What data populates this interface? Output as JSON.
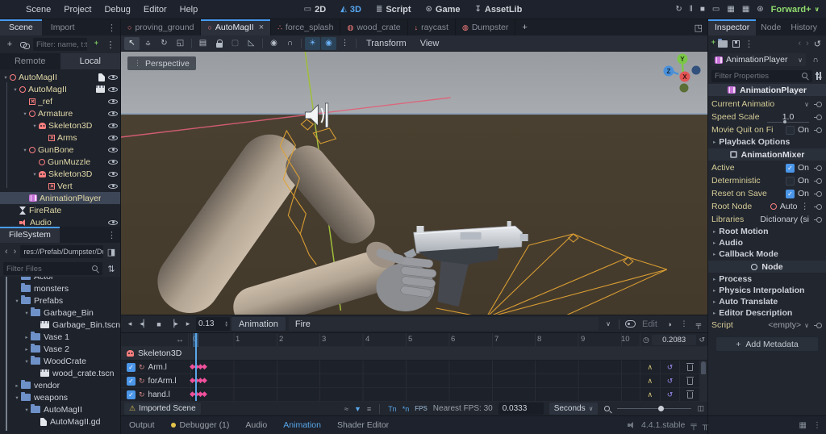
{
  "colors": {
    "accent_blue": "#479df3",
    "node_red": "#fc7f7f",
    "anim_purple": "#c874d8",
    "keyframe_pink": "#ee4f96",
    "bone_orange": "#e0a233",
    "warning_yellow": "#e0c24c",
    "renderer_green": "#8fd96d",
    "folder_blue": "#6e91c8",
    "node_name_gold": "#e3daa9"
  },
  "icons": {
    "kebab": "⋮",
    "chevron_down": "∨",
    "caret_right": "▸",
    "caret_down": "▾",
    "back": "‹",
    "forward": "›",
    "plus": "+",
    "close": "×",
    "warning": "⚠",
    "sun": "☀",
    "environment": "◉",
    "select": "↖",
    "rotate": "↻",
    "scale": "◱",
    "history": "↺",
    "stop": "■",
    "play": "▸",
    "play_back": "◂",
    "bar_l": "▏",
    "bar_r": "▕",
    "pan": "↔",
    "clock": "◷",
    "loop": "↺",
    "wrap": "∧",
    "bezier": "≈",
    "funnel": "▼",
    "list": "≡",
    "onion": "◑",
    "pin": "╤",
    "dock": "╥",
    "grid": "▦",
    "snap": "∩",
    "ruler": "◺",
    "select_list": "▤",
    "group": "▢",
    "maximize": "◳",
    "spin_up": "▴",
    "spin_down": "▾",
    "check": "✓",
    "diamond": "◆",
    "raycast": "↓",
    "particles": "∴",
    "sphere": "◍",
    "circle": "○",
    "fit": "◫",
    "split": "◨",
    "sort": "⇅",
    "move_h": "↔",
    "move_v": "↕",
    "ws_2d": "▭",
    "ws_3d": "◭",
    "ws_script": "≣",
    "ws_game": "⊙",
    "ws_asset": "↧",
    "run_restart": "↻",
    "run_pause": "‖",
    "run_stop": "■",
    "run_remote": "▭",
    "run_movie": "▦",
    "run_custom": "⊛",
    "tn": "Tn",
    "an": "*n"
  },
  "menu_bar": {
    "items": [
      "Scene",
      "Project",
      "Debug",
      "Editor",
      "Help"
    ]
  },
  "workspaces": {
    "items": [
      "2D",
      "3D",
      "Script",
      "Game",
      "AssetLib"
    ]
  },
  "run_bar": {
    "renderer": "Forward+"
  },
  "scene_dock": {
    "tabs": [
      "Scene",
      "Import"
    ],
    "filter_placeholder": "Filter: name, t:t",
    "view_tabs": [
      "Remote",
      "Local"
    ],
    "nodes": [
      {
        "name": "AutoMagII"
      },
      {
        "name": "AutoMagII"
      },
      {
        "name": "_ref"
      },
      {
        "name": "Armature"
      },
      {
        "name": "Skeleton3D"
      },
      {
        "name": "Arms"
      },
      {
        "name": "GunBone"
      },
      {
        "name": "GunMuzzle"
      },
      {
        "name": "Skeleton3D"
      },
      {
        "name": "Vert"
      },
      {
        "name": "AnimationPlayer"
      },
      {
        "name": "FireRate"
      },
      {
        "name": "Audio"
      }
    ]
  },
  "filesystem": {
    "title": "FileSystem",
    "path": "res://Prefab/Dumpster/Du",
    "filter_placeholder": "Filter Files",
    "entries": [
      {
        "name": "Actor"
      },
      {
        "name": "monsters"
      },
      {
        "name": "Prefabs"
      },
      {
        "name": "Garbage_Bin"
      },
      {
        "name": "Garbage_Bin.tscn"
      },
      {
        "name": "Vase 1"
      },
      {
        "name": "Vase 2"
      },
      {
        "name": "WoodCrate"
      },
      {
        "name": "wood_crate.tscn"
      },
      {
        "name": "vendor"
      },
      {
        "name": "weapons"
      },
      {
        "name": "AutoMagII"
      },
      {
        "name": "AutoMagII.gd"
      }
    ]
  },
  "scene_tabs": {
    "tabs": [
      {
        "label": "proving_ground"
      },
      {
        "label": "AutoMagII"
      },
      {
        "label": "force_splash"
      },
      {
        "label": "wood_crate"
      },
      {
        "label": "raycast"
      },
      {
        "label": "Dumpster"
      }
    ]
  },
  "viewport": {
    "projection_label": "Perspective",
    "transform_menu": "Transform",
    "view_menu": "View",
    "gizmo": {
      "x": "X",
      "y": "Y",
      "z": "Z"
    }
  },
  "animation": {
    "time": "0.13",
    "menu_label": "Animation",
    "name": "Fire",
    "edit_label": "Edit",
    "length": "0.2083",
    "group": "Skeleton3D",
    "tracks": [
      {
        "name": "Arm.l"
      },
      {
        "name": "forArm.l"
      },
      {
        "name": "hand.l"
      }
    ],
    "ruler": [
      "0",
      "1",
      "2",
      "3",
      "4",
      "5",
      "6",
      "7",
      "8",
      "9",
      "10"
    ],
    "imported_label": "Imported Scene",
    "fps_small": "FPS",
    "nearest_fps": "Nearest FPS: 30",
    "step": "0.0333",
    "unit": "Seconds"
  },
  "bottom_bar": {
    "tabs": [
      {
        "label": "Output"
      },
      {
        "label": "Debugger (1)"
      },
      {
        "label": "Audio"
      },
      {
        "label": "Animation"
      },
      {
        "label": "Shader Editor"
      }
    ],
    "version": "4.4.1.stable"
  },
  "inspector": {
    "tabs": [
      "Inspector",
      "Node",
      "History"
    ],
    "object_name": "AnimationPlayer",
    "filter_placeholder": "Filter Properties",
    "category": "AnimationPlayer",
    "rows": [
      {
        "label": "Current Animatio"
      },
      {
        "label": "Speed Scale",
        "value": "1.0"
      },
      {
        "label": "Movie Quit on Fi",
        "value": "On"
      },
      {
        "label": "Playback Options"
      },
      {
        "label": "AnimationMixer"
      },
      {
        "label": "Active",
        "value": "On"
      },
      {
        "label": "Deterministic",
        "value": "On"
      },
      {
        "label": "Reset on Save",
        "value": "On"
      },
      {
        "label": "Root Node",
        "value": "Auto"
      },
      {
        "label": "Libraries",
        "value": "Dictionary (si"
      },
      {
        "label": "Root Motion"
      },
      {
        "label": "Audio"
      },
      {
        "label": "Callback Mode"
      },
      {
        "label": "Node"
      },
      {
        "label": "Process"
      },
      {
        "label": "Physics Interpolation"
      },
      {
        "label": "Auto Translate"
      },
      {
        "label": "Editor Description"
      },
      {
        "label": "Script",
        "value": "<empty>"
      }
    ],
    "add_metadata_label": "Add Metadata"
  }
}
